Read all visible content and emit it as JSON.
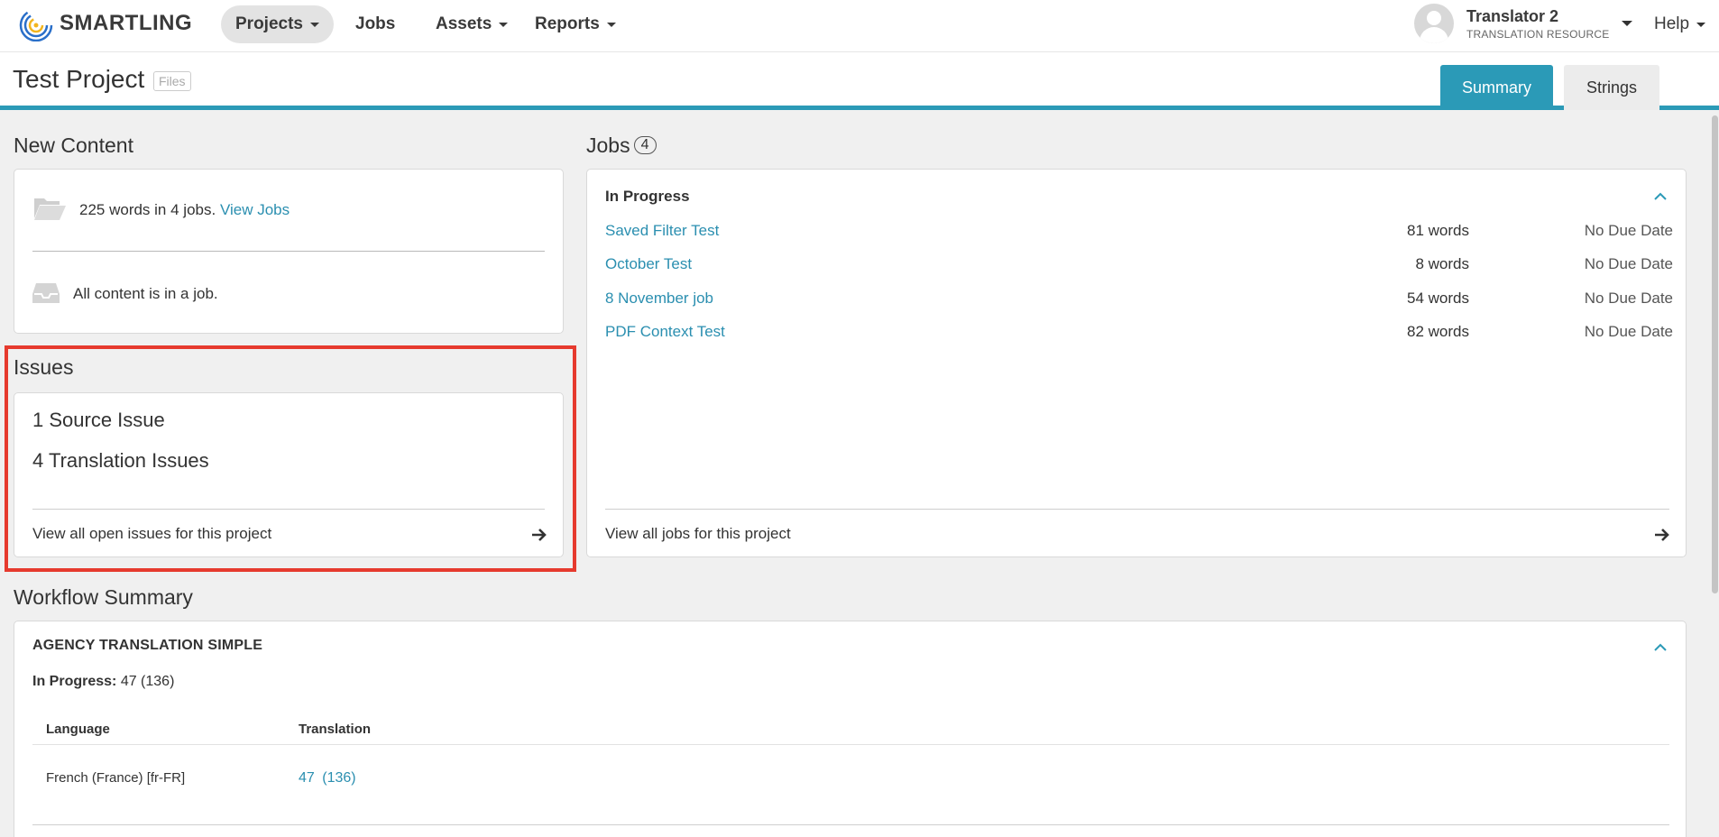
{
  "brand": {
    "name": "SMARTLING",
    "accent": "#2b9ab7",
    "link": "#2b8fb0",
    "highlight": "#e63a2e"
  },
  "nav": {
    "items": [
      {
        "label": "Projects",
        "has_caret": true,
        "active": true
      },
      {
        "label": "Jobs",
        "has_caret": false,
        "active": false
      },
      {
        "label": "Assets",
        "has_caret": true,
        "active": false
      },
      {
        "label": "Reports",
        "has_caret": true,
        "active": false
      }
    ],
    "user": {
      "name": "Translator 2",
      "role": "TRANSLATION RESOURCE",
      "icon": "user-avatar-icon"
    },
    "help": "Help"
  },
  "project": {
    "title": "Test Project",
    "badge": "Files",
    "tabs": {
      "summary": "Summary",
      "strings": "Strings"
    }
  },
  "new_content": {
    "title": "New Content",
    "words_text": "225 words in 4 jobs.",
    "view_jobs": "View Jobs",
    "all_in_job": "All content is in a job.",
    "icons": {
      "folder": "folder-open-icon",
      "inbox": "inbox-icon"
    }
  },
  "issues": {
    "title": "Issues",
    "source": "1 Source Issue",
    "translation": "4 Translation Issues",
    "view_all": "View all open issues for this project"
  },
  "jobs": {
    "title": "Jobs",
    "count": "4",
    "section": "In Progress",
    "rows": [
      {
        "name": "Saved Filter Test",
        "words": "81 words",
        "due": "No Due Date"
      },
      {
        "name": "October Test",
        "words": "8 words",
        "due": "No Due Date"
      },
      {
        "name": "8 November job",
        "words": "54 words",
        "due": "No Due Date"
      },
      {
        "name": "PDF Context Test",
        "words": "82 words",
        "due": "No Due Date"
      }
    ],
    "view_all": "View all jobs for this project"
  },
  "workflow": {
    "title": "Workflow Summary",
    "name": "AGENCY TRANSLATION SIMPLE",
    "in_progress_label": "In Progress:",
    "in_progress_value": "47 (136)",
    "columns": {
      "language": "Language",
      "translation": "Translation"
    },
    "rows": [
      {
        "language": "French (France) [fr-FR]",
        "translation": "47",
        "total": "(136)"
      }
    ]
  }
}
